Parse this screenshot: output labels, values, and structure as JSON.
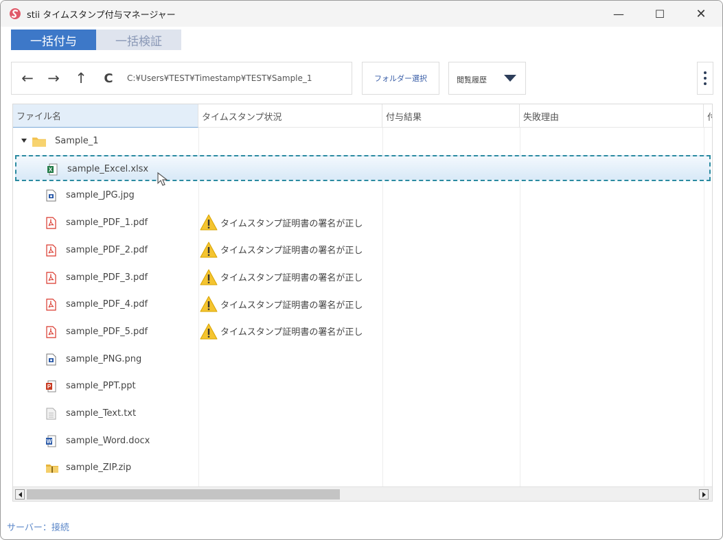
{
  "window": {
    "title": "stii タイムスタンプ付与マネージャー",
    "min_label": "—",
    "max_label": "☐",
    "close_label": "✕"
  },
  "tabs": [
    {
      "label": "一括付与",
      "active": true
    },
    {
      "label": "一括検証",
      "active": false
    }
  ],
  "toolbar": {
    "back_icon": "←",
    "forward_icon": "→",
    "up_icon": "↑",
    "refresh_icon": "C",
    "path": "C:¥Users¥TEST¥Timestamp¥TEST¥Sample_1",
    "folder_select_label": "フォルダー選択",
    "history_label": "閲覧履歴"
  },
  "grid": {
    "columns": [
      "ファイル名",
      "タイムスタンプ状況",
      "付与結果",
      "失敗理由",
      "付"
    ],
    "folder": "Sample_1",
    "rows": [
      {
        "name": "sample_Excel.xlsx",
        "icon": "excel-icon",
        "status": "",
        "selected": true
      },
      {
        "name": "sample_JPG.jpg",
        "icon": "image-icon",
        "status": ""
      },
      {
        "name": "sample_PDF_1.pdf",
        "icon": "pdf-icon",
        "status": "タイムスタンプ証明書の署名が正し"
      },
      {
        "name": "sample_PDF_2.pdf",
        "icon": "pdf-icon",
        "status": "タイムスタンプ証明書の署名が正し"
      },
      {
        "name": "sample_PDF_3.pdf",
        "icon": "pdf-icon",
        "status": "タイムスタンプ証明書の署名が正し"
      },
      {
        "name": "sample_PDF_4.pdf",
        "icon": "pdf-icon",
        "status": "タイムスタンプ証明書の署名が正し"
      },
      {
        "name": "sample_PDF_5.pdf",
        "icon": "pdf-icon",
        "status": "タイムスタンプ証明書の署名が正し"
      },
      {
        "name": "sample_PNG.png",
        "icon": "image-icon",
        "status": ""
      },
      {
        "name": "sample_PPT.ppt",
        "icon": "powerpoint-icon",
        "status": ""
      },
      {
        "name": "sample_Text.txt",
        "icon": "text-file-icon",
        "status": ""
      },
      {
        "name": "sample_Word.docx",
        "icon": "word-icon",
        "status": ""
      },
      {
        "name": "sample_ZIP.zip",
        "icon": "zip-icon",
        "status": ""
      }
    ]
  },
  "statusbar": {
    "server_status": "サーバー：接続"
  },
  "colors": {
    "accent": "#3d78c8",
    "selection_border": "#2a8aa0",
    "warning": "#f4c430",
    "pdf_red": "#d9362b",
    "excel_green": "#1f7a45",
    "word_blue": "#2b5aa8",
    "ppt_red": "#c83b22"
  }
}
